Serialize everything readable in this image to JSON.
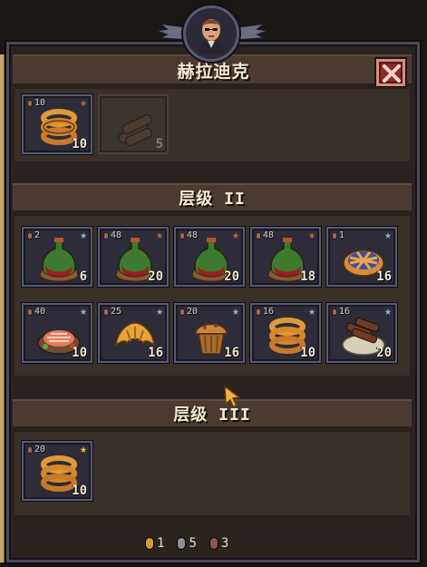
{
  "header": {
    "title": "赫拉迪克",
    "portrait_icon": "character-portrait-icon",
    "close_icon": "close-x-icon"
  },
  "top_slots": [
    {
      "pips": "10",
      "star": "bronze",
      "count": "10",
      "icon": "onion-rings-icon",
      "locked": false
    },
    {
      "pips": "",
      "star": "",
      "count": "5",
      "icon": "firewood-icon",
      "locked": true
    }
  ],
  "tier2": {
    "label": "层级 II",
    "slots": [
      {
        "pips": "2",
        "star": "silver",
        "count": "6",
        "icon": "red-wine-bottle-icon"
      },
      {
        "pips": "48",
        "star": "bronze",
        "count": "20",
        "icon": "red-wine-bottle-icon"
      },
      {
        "pips": "48",
        "star": "bronze",
        "count": "20",
        "icon": "red-wine-bottle-icon"
      },
      {
        "pips": "48",
        "star": "bronze",
        "count": "18",
        "icon": "red-wine-bottle-icon"
      },
      {
        "pips": "1",
        "star": "silver",
        "count": "16",
        "icon": "blueberry-pie-icon"
      },
      {
        "pips": "40",
        "star": "silver",
        "count": "10",
        "icon": "salmon-dish-icon"
      },
      {
        "pips": "25",
        "star": "silver",
        "count": "16",
        "icon": "croissant-icon"
      },
      {
        "pips": "20",
        "star": "silver",
        "count": "16",
        "icon": "muffin-icon"
      },
      {
        "pips": "16",
        "star": "silver",
        "count": "10",
        "icon": "onion-rings-icon"
      },
      {
        "pips": "16",
        "star": "silver",
        "count": "20",
        "icon": "meat-platter-icon"
      }
    ]
  },
  "tier3": {
    "label": "层级 III",
    "slots": [
      {
        "pips": "20",
        "star": "gold",
        "count": "10",
        "icon": "onion-rings-icon"
      }
    ]
  },
  "footer": {
    "gold": "1",
    "silver": "5",
    "bronze": "3"
  },
  "colors": {
    "star_gold": "#f2c23a",
    "star_silver": "#8fb0c8",
    "star_bronze": "#b06a4e",
    "close_red": "#8b2b26",
    "panel_bg": "#2a2320"
  }
}
